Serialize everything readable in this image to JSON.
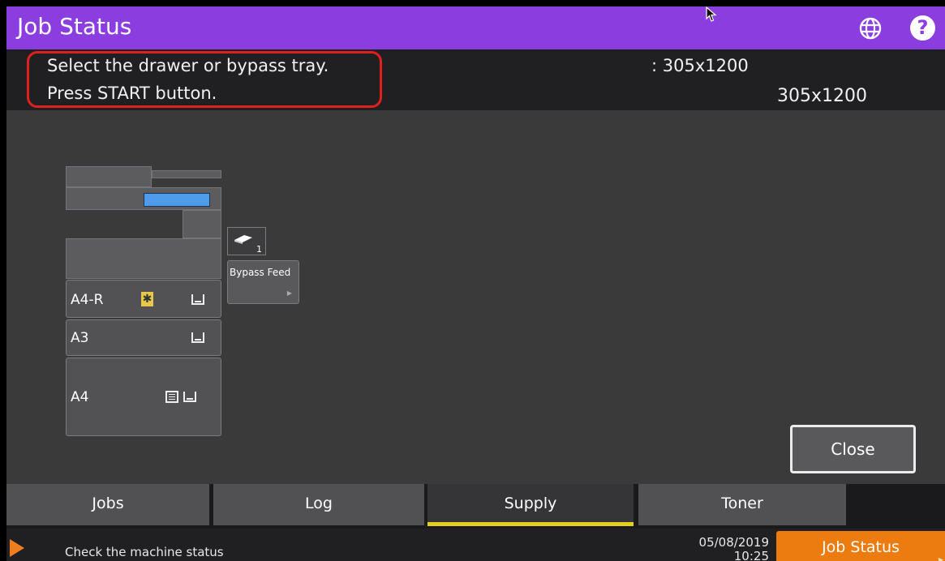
{
  "header": {
    "title": "Job Status",
    "globe_icon": "globe-icon",
    "help_label": "?"
  },
  "message": {
    "line1": "Select the drawer or bypass tray.",
    "line2": "Press START button.",
    "size_label": ": 305x1200",
    "size_value": "305x1200"
  },
  "drawers": [
    {
      "label": "A4-R"
    },
    {
      "label": "A3"
    },
    {
      "label": "A4"
    }
  ],
  "bypass": {
    "label": "Bypass Feed",
    "count": "1"
  },
  "buttons": {
    "close": "Close"
  },
  "tabs": [
    {
      "label": "Jobs",
      "active": false
    },
    {
      "label": "Log",
      "active": false
    },
    {
      "label": "Supply",
      "active": true
    },
    {
      "label": "Toner",
      "active": false
    }
  ],
  "status": {
    "text": "Check the machine status",
    "date": "05/08/2019",
    "time": "10:25",
    "job_status_button": "Job Status"
  },
  "colors": {
    "header": "#8b3de0",
    "highlight_border": "#e0201c",
    "active_tab_underline": "#e5cf1e",
    "job_status_button": "#ec7c10"
  }
}
